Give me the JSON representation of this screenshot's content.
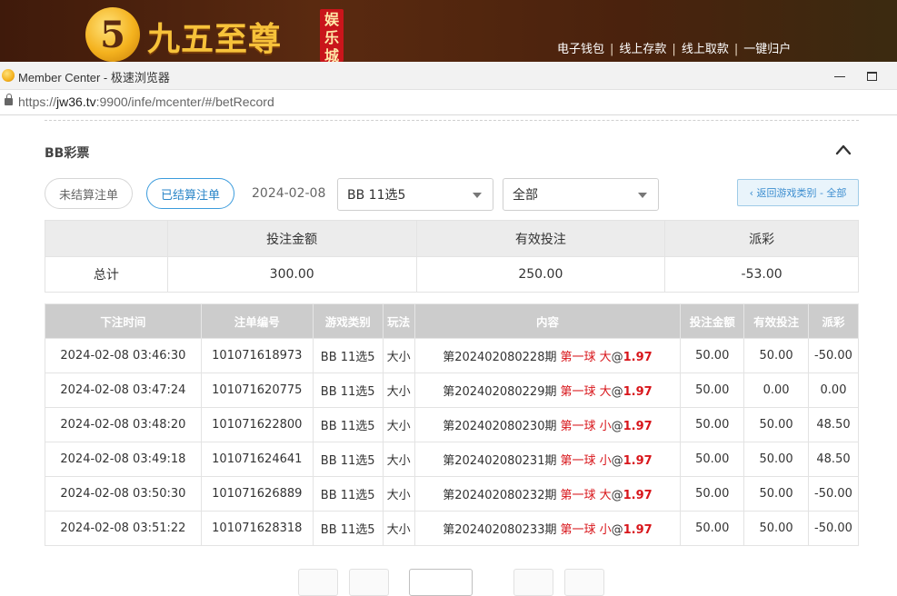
{
  "site": {
    "logo_char": "5",
    "logo_text": "九五至尊",
    "logo_tag": "娱乐城",
    "nav": [
      "电子钱包",
      "线上存款",
      "线上取款",
      "一键归户"
    ]
  },
  "browser": {
    "title": "Member Center - 极速浏览器",
    "url_scheme": "https://",
    "url_host": "jw36.tv",
    "url_rest": ":9900/infe/mcenter/#/betRecord"
  },
  "section": {
    "title": "BB彩票"
  },
  "filters": {
    "unsettled_label": "未结算注单",
    "settled_label": "已结算注单",
    "date": "2024-02-08",
    "game_select": "BB 11选5",
    "type_select": "全部",
    "back_label": "‹ 返回游戏类别 - 全部"
  },
  "summary": {
    "headers": [
      "投注金额",
      "有效投注",
      "派彩"
    ],
    "row_label": "总计",
    "values": [
      "300.00",
      "250.00",
      "-53.00"
    ]
  },
  "bets": {
    "headers": [
      "下注时间",
      "注单编号",
      "游戏类别",
      "玩法",
      "内容",
      "投注金额",
      "有效投注",
      "派彩"
    ],
    "rows": [
      {
        "time": "2024-02-08 03:46:30",
        "id": "101071618973",
        "game": "BB 11选5",
        "play": "大小",
        "period": "第202402080228期",
        "pick": "第一球 大",
        "at": "@",
        "odds": "1.97",
        "amount": "50.00",
        "valid": "50.00",
        "payout": "-50.00"
      },
      {
        "time": "2024-02-08 03:47:24",
        "id": "101071620775",
        "game": "BB 11选5",
        "play": "大小",
        "period": "第202402080229期",
        "pick": "第一球 大",
        "at": "@",
        "odds": "1.97",
        "amount": "50.00",
        "valid": "0.00",
        "payout": "0.00"
      },
      {
        "time": "2024-02-08 03:48:20",
        "id": "101071622800",
        "game": "BB 11选5",
        "play": "大小",
        "period": "第202402080230期",
        "pick": "第一球 小",
        "at": "@",
        "odds": "1.97",
        "amount": "50.00",
        "valid": "50.00",
        "payout": "48.50"
      },
      {
        "time": "2024-02-08 03:49:18",
        "id": "101071624641",
        "game": "BB 11选5",
        "play": "大小",
        "period": "第202402080231期",
        "pick": "第一球 小",
        "at": "@",
        "odds": "1.97",
        "amount": "50.00",
        "valid": "50.00",
        "payout": "48.50"
      },
      {
        "time": "2024-02-08 03:50:30",
        "id": "101071626889",
        "game": "BB 11选5",
        "play": "大小",
        "period": "第202402080232期",
        "pick": "第一球 大",
        "at": "@",
        "odds": "1.97",
        "amount": "50.00",
        "valid": "50.00",
        "payout": "-50.00"
      },
      {
        "time": "2024-02-08 03:51:22",
        "id": "101071628318",
        "game": "BB 11选5",
        "play": "大小",
        "period": "第202402080233期",
        "pick": "第一球 小",
        "at": "@",
        "odds": "1.97",
        "amount": "50.00",
        "valid": "50.00",
        "payout": "-50.00"
      }
    ]
  },
  "colors": {
    "negative": "#e8363b",
    "accent": "#3b9bdc",
    "pick": "#d8161b"
  },
  "icons": {
    "collapse": "chevron-up-icon",
    "lock": "lock-icon",
    "minimize": "minimize-icon",
    "maximize": "maximize-icon"
  }
}
